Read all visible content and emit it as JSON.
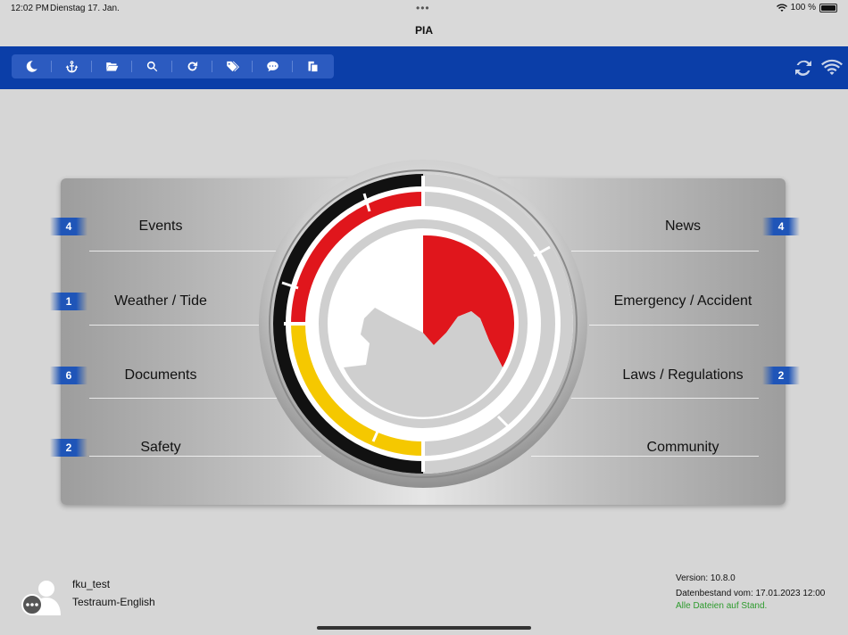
{
  "status": {
    "time": "12:02 PM",
    "date": "Dienstag 17. Jan.",
    "dots": "•••",
    "battery": "100 %"
  },
  "app": {
    "title": "PIA"
  },
  "toolbar": {
    "buttons": [
      "moon-icon",
      "anchor-icon",
      "folder-open-icon",
      "search-icon",
      "refresh-icon",
      "tags-icon",
      "comment-icon",
      "copy-icon"
    ],
    "right": [
      "sync-icon",
      "wifi-icon"
    ]
  },
  "menu": {
    "left": [
      {
        "label": "Events",
        "badge": "4"
      },
      {
        "label": "Weather / Tide",
        "badge": "1"
      },
      {
        "label": "Documents",
        "badge": "6"
      },
      {
        "label": "Safety",
        "badge": "2"
      }
    ],
    "right": [
      {
        "label": "News",
        "badge": "4"
      },
      {
        "label": "Emergency / Accident",
        "badge": ""
      },
      {
        "label": "Laws / Regulations",
        "badge": "2"
      },
      {
        "label": "Community",
        "badge": ""
      }
    ]
  },
  "colors": {
    "toolbar": "#0b3ea8",
    "badge": "#1f55b8",
    "red": "#e0161c",
    "yellow": "#f5c800",
    "black": "#111111",
    "ok": "#2d9b2d"
  },
  "user": {
    "name": "fku_test",
    "room": "Testraum-English"
  },
  "footer": {
    "version": "Version: 10.8.0",
    "databank": "Datenbestand vom: 17.01.2023 12:00",
    "files_status": "Alle Dateien auf Stand."
  }
}
